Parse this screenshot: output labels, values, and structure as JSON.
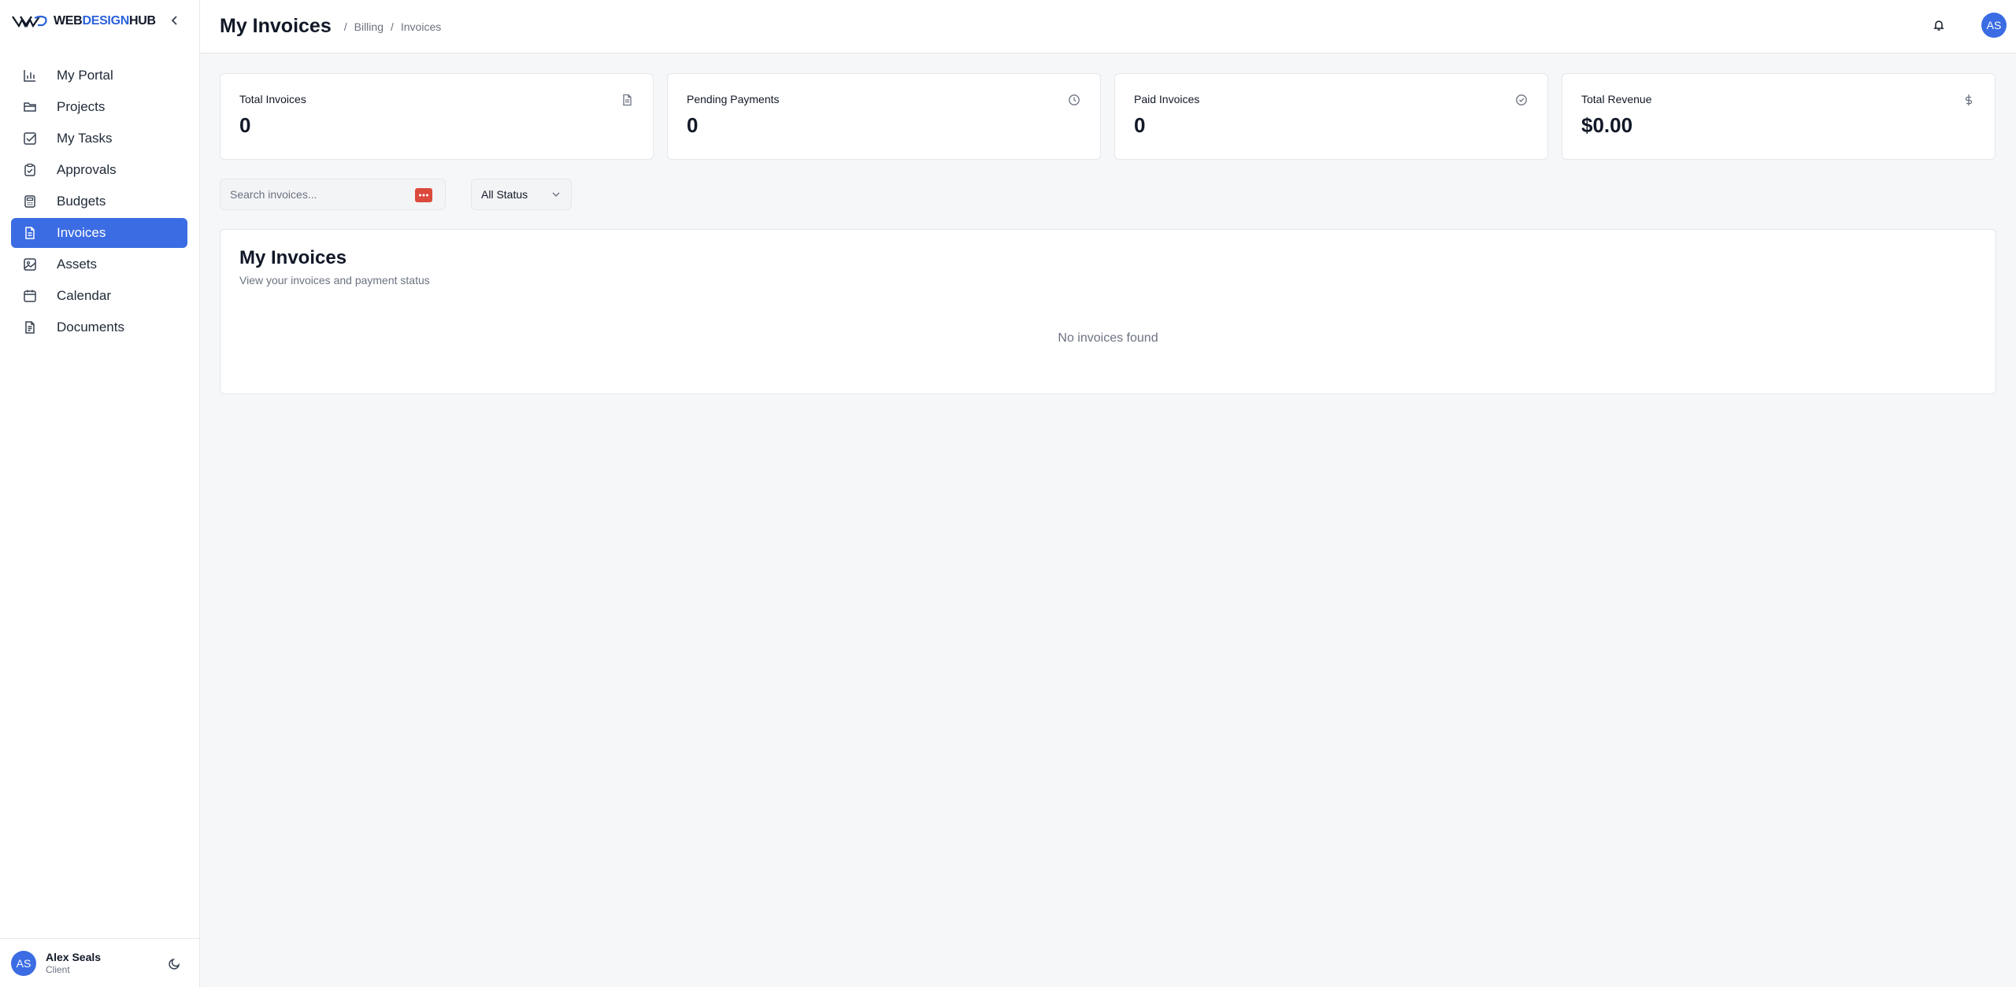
{
  "brand": {
    "name_part1": "WEB",
    "name_part2": "DESIGN",
    "name_part3": "HUB",
    "accent_color": "#3b6ce3"
  },
  "sidebar": {
    "items": [
      {
        "label": "My Portal",
        "icon": "bar-chart-icon",
        "active": false
      },
      {
        "label": "Projects",
        "icon": "folder-icon",
        "active": false
      },
      {
        "label": "My Tasks",
        "icon": "checkbox-icon",
        "active": false
      },
      {
        "label": "Approvals",
        "icon": "clipboard-check-icon",
        "active": false
      },
      {
        "label": "Budgets",
        "icon": "calculator-icon",
        "active": false
      },
      {
        "label": "Invoices",
        "icon": "file-text-icon",
        "active": true
      },
      {
        "label": "Assets",
        "icon": "image-icon",
        "active": false
      },
      {
        "label": "Calendar",
        "icon": "calendar-icon",
        "active": false
      },
      {
        "label": "Documents",
        "icon": "document-icon",
        "active": false
      }
    ],
    "user": {
      "initials": "AS",
      "name": "Alex Seals",
      "role": "Client"
    }
  },
  "header": {
    "title": "My Invoices",
    "breadcrumb": [
      "Billing",
      "Invoices"
    ],
    "avatar_initials": "AS"
  },
  "stats": [
    {
      "label": "Total Invoices",
      "value": "0",
      "icon": "file-icon"
    },
    {
      "label": "Pending Payments",
      "value": "0",
      "icon": "clock-icon"
    },
    {
      "label": "Paid Invoices",
      "value": "0",
      "icon": "check-circle-icon"
    },
    {
      "label": "Total Revenue",
      "value": "$0.00",
      "icon": "dollar-icon"
    }
  ],
  "filters": {
    "search_placeholder": "Search invoices...",
    "status_value": "All Status"
  },
  "panel": {
    "title": "My Invoices",
    "subtitle": "View your invoices and payment status",
    "empty_message": "No invoices found"
  }
}
